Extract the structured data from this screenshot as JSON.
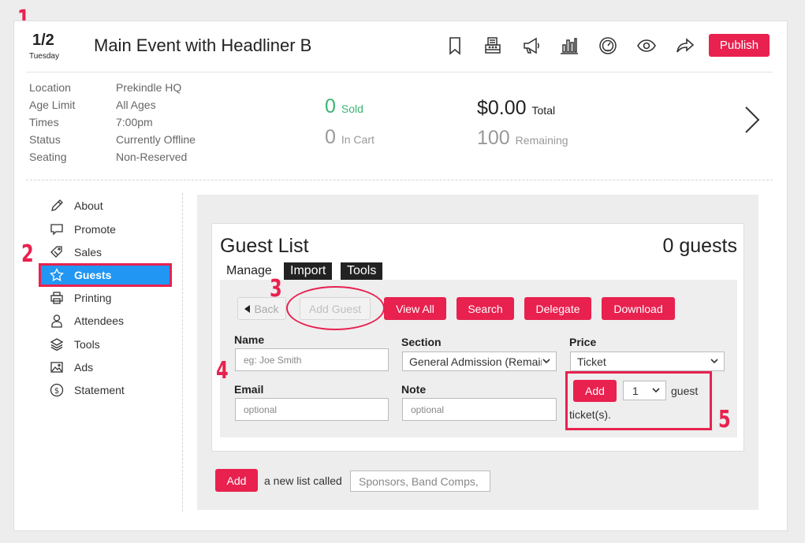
{
  "annotations": [
    "1",
    "2",
    "3",
    "4",
    "5"
  ],
  "header": {
    "date": "1/2",
    "day": "Tuesday",
    "title": "Main Event with Headliner B",
    "publish_label": "Publish",
    "icons": [
      "bookmark-icon",
      "register-icon",
      "megaphone-icon",
      "bar-chart-icon",
      "gauge-icon",
      "eye-icon",
      "share-icon"
    ]
  },
  "info": {
    "labels": [
      "Location",
      "Age Limit",
      "Times",
      "Status",
      "Seating"
    ],
    "values": [
      "Prekindle HQ",
      "All Ages",
      "7:00pm",
      "Currently Offline",
      "Non-Reserved"
    ]
  },
  "stats": {
    "sold_value": "0",
    "sold_label": "Sold",
    "cart_value": "0",
    "cart_label": "In Cart",
    "total_value": "$0.00",
    "total_label": "Total",
    "remaining_value": "100",
    "remaining_label": "Remaining"
  },
  "sidebar": {
    "items": [
      {
        "label": "About",
        "icon": "pencil-icon"
      },
      {
        "label": "Promote",
        "icon": "speech-bubble-icon"
      },
      {
        "label": "Sales",
        "icon": "tag-icon"
      },
      {
        "label": "Guests",
        "icon": "star-icon"
      },
      {
        "label": "Printing",
        "icon": "printer-icon"
      },
      {
        "label": "Attendees",
        "icon": "person-icon"
      },
      {
        "label": "Tools",
        "icon": "layers-icon"
      },
      {
        "label": "Ads",
        "icon": "image-icon"
      },
      {
        "label": "Statement",
        "icon": "dollar-circle-icon"
      }
    ],
    "active": "Guests"
  },
  "guest_list": {
    "title": "Guest List",
    "count": "0 guests",
    "tabs": [
      "Manage",
      "Import",
      "Tools"
    ],
    "buttons": {
      "back": "Back",
      "add_guest": "Add Guest",
      "view_all": "View All",
      "search": "Search",
      "delegate": "Delegate",
      "download": "Download"
    },
    "form": {
      "name_label": "Name",
      "name_placeholder": "eg: Joe Smith",
      "section_label": "Section",
      "section_value": "General Admission (Remaining)",
      "price_label": "Price",
      "price_value": "Ticket",
      "email_label": "Email",
      "email_placeholder": "optional",
      "note_label": "Note",
      "note_placeholder": "optional",
      "add_label": "Add",
      "qty_value": "1",
      "guest_text": "guest",
      "tickets_text": "ticket(s)."
    }
  },
  "new_list": {
    "add_label": "Add",
    "text": "a new list called",
    "placeholder": "Sponsors, Band Comps, etc."
  },
  "colors": {
    "accent": "#e8214f",
    "active_nav": "#2196f3",
    "sold_green": "#3cb371"
  }
}
